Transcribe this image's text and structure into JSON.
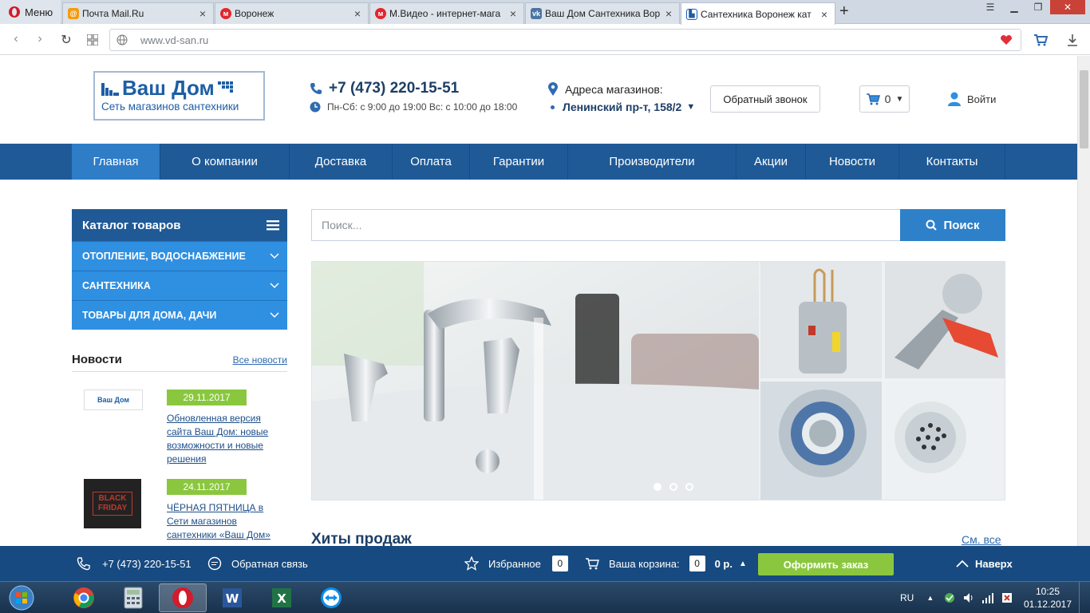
{
  "browser": {
    "menu_label": "Меню",
    "tabs": [
      {
        "title": "Почта Mail.Ru",
        "icon": "mailru-icon"
      },
      {
        "title": "Воронеж",
        "icon": "mvideo-icon"
      },
      {
        "title": "М.Видео - интернет-мага",
        "icon": "mvideo-icon"
      },
      {
        "title": "Ваш Дом Сантехника Вор",
        "icon": "vk-icon"
      },
      {
        "title": "Сантехника Воронеж кат",
        "icon": "vdsan-icon",
        "active": true
      }
    ],
    "url": "www.vd-san.ru"
  },
  "header": {
    "logo_title": "Ваш Дом",
    "logo_subtitle": "Сеть магазинов сантехники",
    "phone": "+7 (473) 220-15-51",
    "hours": "Пн-Сб: с 9:00 до 19:00 Вс: с 10:00 до 18:00",
    "address_title": "Адреса магазинов:",
    "address_value": "Ленинский пр-т, 158/2",
    "callback_label": "Обратный звонок",
    "cart_count": "0",
    "login_label": "Войти"
  },
  "nav": {
    "items": [
      "Главная",
      "О компании",
      "Доставка",
      "Оплата",
      "Гарантии",
      "Производители",
      "Акции",
      "Новости",
      "Контакты"
    ]
  },
  "catalog": {
    "title": "Каталог товаров",
    "items": [
      "ОТОПЛЕНИЕ, ВОДОСНАБЖЕНИЕ",
      "САНТЕХНИКА",
      "ТОВАРЫ ДЛЯ ДОМА, ДАЧИ"
    ]
  },
  "news": {
    "title": "Новости",
    "all_link": "Все новости",
    "items": [
      {
        "date": "29.11.2017",
        "text": "Обновленная версия сайта Ваш Дом: новые возможности и новые решения",
        "thumb_text": "Ваш Дом"
      },
      {
        "date": "24.11.2017",
        "text": "ЧЁРНАЯ ПЯТНИЦА в Сети магазинов сантехники «Ваш Дом»",
        "thumb_text": "BLACK FRIDAY"
      }
    ]
  },
  "search": {
    "placeholder": "Поиск...",
    "button_label": "Поиск"
  },
  "banner": {
    "slides": 3,
    "active_slide": 1
  },
  "hits": {
    "title": "Хиты продаж",
    "see_all": "См. все"
  },
  "fixed_bar": {
    "phone": "+7 (473) 220-15-51",
    "feedback": "Обратная связь",
    "favorites_label": "Избранное",
    "favorites_count": "0",
    "cart_label": "Ваша корзина:",
    "cart_count": "0",
    "cart_sum": "0 р.",
    "order_button": "Оформить заказ",
    "up_label": "Наверх"
  },
  "taskbar": {
    "lang": "RU",
    "time": "10:25",
    "date": "01.12.2017"
  },
  "colors": {
    "nav_blue": "#1f5a97",
    "accent_blue": "#2f8fe1",
    "green": "#8ac73e"
  }
}
